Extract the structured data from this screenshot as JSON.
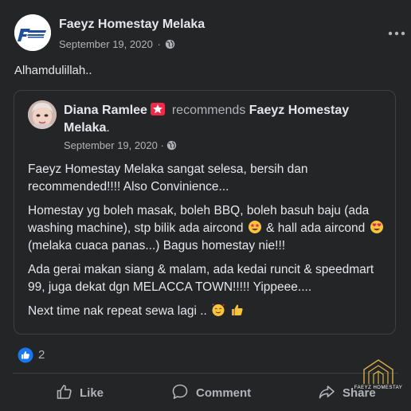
{
  "post": {
    "page_name": "Faeyz Homestay Melaka",
    "date": "September 19, 2020",
    "separator": "·",
    "caption": "Alhamdulillah.."
  },
  "review": {
    "reviewer_name": "Diana Ramlee",
    "verb": "recommends",
    "target_name": "Faeyz Homestay Melaka",
    "target_suffix": ".",
    "date": "September 19, 2020",
    "separator": "·",
    "p1": "Faeyz Homestay Melaka sangat selesa, bersih dan recommended!!!! Also Convinience...",
    "p2_a": "Homestay yg boleh masak, boleh BBQ, boleh basuh baju (ada washing machine), stp bilik ada aircond",
    "p2_b": "& hall ada aircond",
    "p2_c": "(melaka cuaca panas...) Bagus homestay nie!!!",
    "p3": "Ada gerai makan siang & malam, ada kedai runcit & speedmart 99, juga dekat dgn MELACCA TOWN!!!!! Yippeee....",
    "p4": "Next time nak repeat sewa lagi .."
  },
  "reactions": {
    "count": "2",
    "icon": "like-reaction-icon"
  },
  "actions": {
    "like": "Like",
    "comment": "Comment",
    "share": "Share"
  },
  "watermark": {
    "text": "FAEYZ HOMESTAY"
  },
  "colors": {
    "background": "#242526",
    "text": "#e4e6eb",
    "muted": "#b0b3b8",
    "like_blue": "#1877f2",
    "recommend_red": "#f02849",
    "border": "#3e4042"
  },
  "icons": [
    "globe-icon",
    "more-icon",
    "recommend-icon",
    "like-icon",
    "comment-icon",
    "share-icon",
    "house-logo-icon"
  ]
}
